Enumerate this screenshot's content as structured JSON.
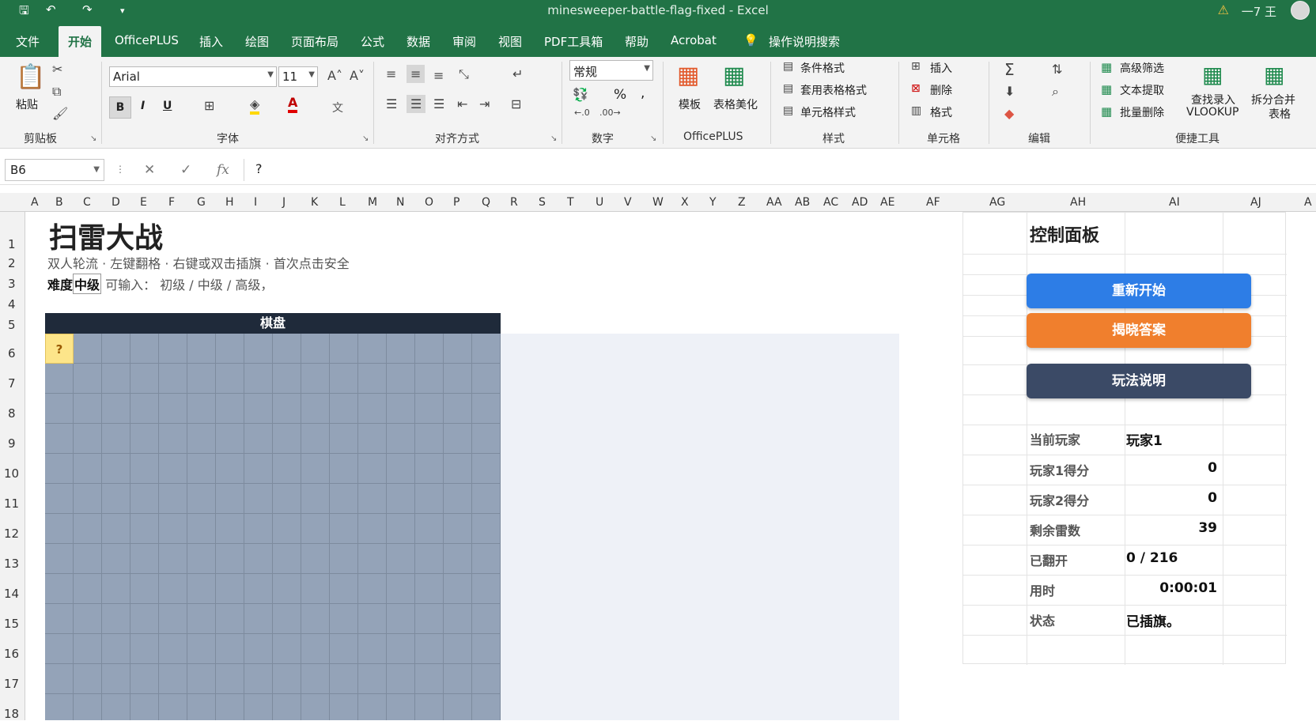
{
  "window": {
    "title": "minesweeper-battle-flag-fixed  -  Excel",
    "user": "一7 王"
  },
  "tabs": [
    "文件",
    "开始",
    "OfficePLUS",
    "插入",
    "绘图",
    "页面布局",
    "公式",
    "数据",
    "审阅",
    "视图",
    "PDF工具箱",
    "帮助",
    "Acrobat"
  ],
  "search_label": "操作说明搜索",
  "ribbon": {
    "clipboard": {
      "paste": "粘贴",
      "label": "剪贴板"
    },
    "font": {
      "name": "Arial",
      "size": "11",
      "label": "字体",
      "bold": "B",
      "italic": "I",
      "underline": "U",
      "wen": "文"
    },
    "align": {
      "label": "对齐方式"
    },
    "number": {
      "format": "常规",
      "percent": "%",
      "comma": ",",
      "label": "数字"
    },
    "officeplus": {
      "template": "模板",
      "beautify": "表格美化",
      "label": "OfficePLUS"
    },
    "styles": {
      "cond": "条件格式",
      "table": "套用表格格式",
      "cell": "单元格样式",
      "label": "样式"
    },
    "cells": {
      "insert": "插入",
      "delete": "删除",
      "format": "格式",
      "label": "单元格"
    },
    "edit": {
      "label": "编辑"
    },
    "tools": {
      "filter": "高级筛选",
      "extract": "文本提取",
      "batchdel": "批量删除",
      "lookup1": "查找录入",
      "lookup2": "VLOOKUP",
      "split1": "拆分合并",
      "split2": "表格",
      "label": "便捷工具"
    }
  },
  "formula_bar": {
    "name_box": "B6",
    "value": "?",
    "fx": "fx"
  },
  "columns": [
    "A",
    "B",
    "C",
    "D",
    "E",
    "F",
    "G",
    "H",
    "I",
    "J",
    "K",
    "L",
    "M",
    "N",
    "O",
    "P",
    "Q",
    "R",
    "S",
    "T",
    "U",
    "V",
    "W",
    "X",
    "Y",
    "Z",
    "AA",
    "AB",
    "AC",
    "AD",
    "AE",
    "AF",
    "AG",
    "AH",
    "AI",
    "AJ",
    "A"
  ],
  "rows": [
    "1",
    "2",
    "3",
    "4",
    "5",
    "6",
    "7",
    "8",
    "9",
    "10",
    "11",
    "12",
    "13",
    "14",
    "15",
    "16",
    "17",
    "18"
  ],
  "sheet": {
    "title": "扫雷大战",
    "subtitle": "双人轮流 · 左键翻格 · 右键或双击插旗 · 首次点击安全",
    "difficulty_label": "难度",
    "difficulty_value": "中级",
    "difficulty_hint": "可输入：  初级 / 中级 / 高级，",
    "board_title": "棋盘",
    "selected_cell": "?"
  },
  "panel": {
    "title": "控制面板",
    "restart": "重新开始",
    "reveal": "揭晓答案",
    "help": "玩法说明",
    "stats": [
      {
        "k": "当前玩家",
        "v": "玩家1"
      },
      {
        "k": "玩家1得分",
        "v": "0"
      },
      {
        "k": "玩家2得分",
        "v": "0"
      },
      {
        "k": "剩余雷数",
        "v": "39"
      },
      {
        "k": "已翻开",
        "v": "0 / 216"
      },
      {
        "k": "用时",
        "v": "0:00:01"
      },
      {
        "k": "状态",
        "v": "已插旗。"
      }
    ]
  },
  "colors": {
    "excel_green": "#217346",
    "restart": "#2d7de6",
    "reveal": "#f07f2d",
    "help": "#3b4a66",
    "board": "#94a3b8",
    "board_header": "#1f2a3a",
    "selected": "#fde58a"
  }
}
